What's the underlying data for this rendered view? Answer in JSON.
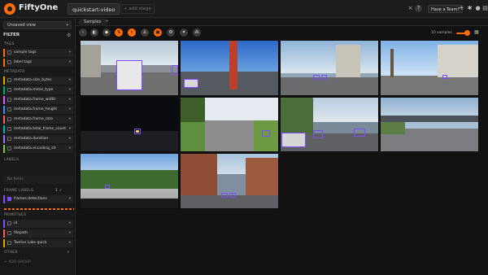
{
  "app": {
    "title": "FiftyOne",
    "dataset": "quickstart-video",
    "add_stage": "+ add stage"
  },
  "topbar": {
    "team_label": "Have a Team?",
    "close": "×",
    "help": "?"
  },
  "sidebar": {
    "view": "Unsaved view",
    "filter_title": "FILTER",
    "sections": {
      "tags": "TAGS",
      "metadata": "METADATA",
      "labels": "LABELS",
      "frame_labels": "FRAME LABELS",
      "primitives": "PRIMITIVES",
      "other": "OTHER"
    },
    "tags": [
      {
        "label": "sample tags",
        "color": "#ff6d04"
      },
      {
        "label": "label tags",
        "color": "#ff6d04"
      }
    ],
    "metadata": [
      {
        "label": "metadata.size_bytes",
        "color": "#e7a000"
      },
      {
        "label": "metadata.mime_type",
        "color": "#00a86b"
      },
      {
        "label": "metadata.frame_width",
        "color": "#d15cff"
      },
      {
        "label": "metadata.frame_height",
        "color": "#3c8cff"
      },
      {
        "label": "metadata.frame_rate",
        "color": "#ff5a5a"
      },
      {
        "label": "metadata.total_frame_count",
        "color": "#00b3b3"
      },
      {
        "label": "metadata.duration",
        "color": "#9a6cff"
      },
      {
        "label": "metadata.encoding_str",
        "color": "#7ac74f"
      }
    ],
    "no_fields": "No fields",
    "frame_labels": [
      {
        "label": "frames.detections",
        "color": "#7d4dff"
      }
    ],
    "frame_labels_badge": "1 ✓",
    "primitives": [
      {
        "label": "id",
        "color": "#7d4dff"
      },
      {
        "label": "filepath",
        "color": "#ff5a5a"
      },
      {
        "label": "Twelve Labs quick",
        "color": "#e7a000"
      }
    ],
    "add_group": "+ ADD GROUP"
  },
  "content": {
    "tab": "Samples",
    "tab_add": "+",
    "count": "10 samples"
  },
  "colors": {
    "accent": "#ff6d04",
    "box": "#7d4dff",
    "background": "#121212"
  },
  "thumbnails": [
    {
      "scene": "street-truck-day"
    },
    {
      "scene": "bridge-road"
    },
    {
      "scene": "city-street-day"
    },
    {
      "scene": "palm-street"
    },
    {
      "scene": "night-road"
    },
    {
      "scene": "suburban-road"
    },
    {
      "scene": "urban-traffic"
    },
    {
      "scene": "highway-overpass"
    },
    {
      "scene": "dashcam-trees"
    },
    {
      "scene": "brick-buildings"
    }
  ]
}
